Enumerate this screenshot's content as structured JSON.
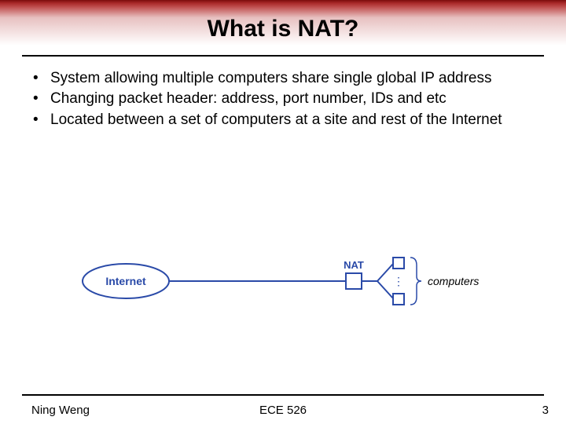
{
  "title": "What is NAT?",
  "bullets": [
    "System allowing multiple computers share single global IP address",
    "Changing packet header: address, port number, IDs and etc",
    "Located between a set of computers at a site and rest of the Internet"
  ],
  "diagram": {
    "internet_label": "Internet",
    "nat_label": "NAT",
    "computers_label": "computers",
    "dots": "⋮"
  },
  "footer": {
    "author": "Ning Weng",
    "course": "ECE 526",
    "page": "3"
  }
}
